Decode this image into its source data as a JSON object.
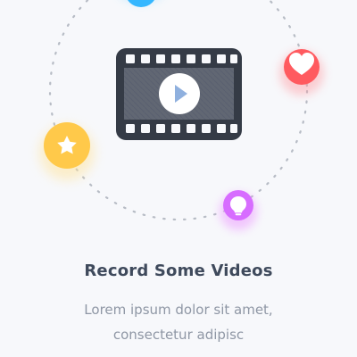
{
  "onboarding": {
    "title": "Record Some Videos",
    "description_lines": [
      "Lorem ipsum dolor sit amet,",
      "consectetur adipisc"
    ]
  },
  "illustration": {
    "center_icon": "video-film-play-icon",
    "orbit_icons": [
      {
        "name": "blue-circle-icon",
        "color": "#35b7ff"
      },
      {
        "name": "heart-icon",
        "color": "#ff5a5f"
      },
      {
        "name": "star-icon",
        "color": "#ffc94a"
      },
      {
        "name": "lightbulb-icon",
        "color": "#d76cff"
      }
    ]
  }
}
